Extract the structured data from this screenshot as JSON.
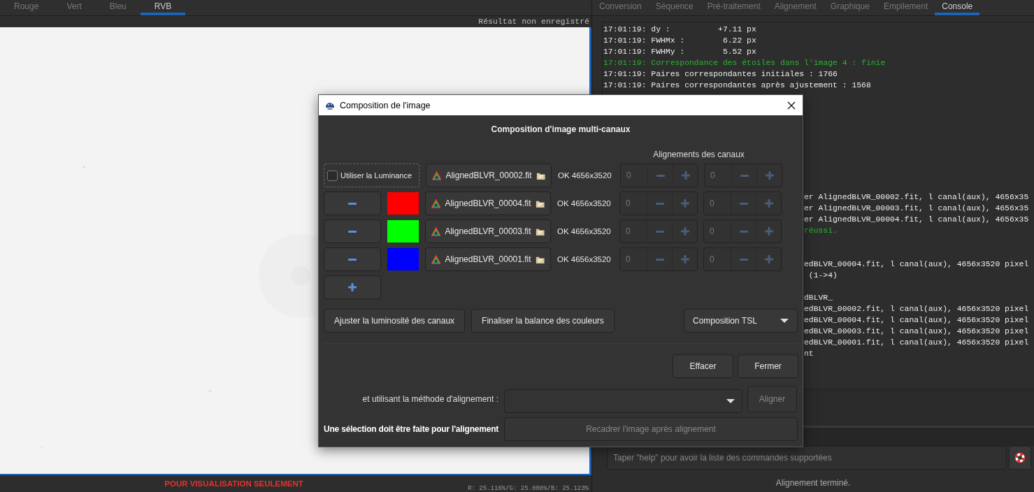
{
  "viewer": {
    "tabs": [
      {
        "label": "Rouge",
        "selected": false
      },
      {
        "label": "Vert",
        "selected": false
      },
      {
        "label": "Bleu",
        "selected": false
      },
      {
        "label": "RVB",
        "selected": true
      }
    ],
    "save_state": "Résultat non enregistré",
    "notice": "POUR VISUALISATION SEULEMENT",
    "pixel_values": "R: 25.116%/G: 25.008%/B: 25.123%"
  },
  "panel": {
    "tabs": [
      {
        "label": "Conversion",
        "selected": false
      },
      {
        "label": "Séquence",
        "selected": false
      },
      {
        "label": "Pré-traitement",
        "selected": false
      },
      {
        "label": "Alignement",
        "selected": false
      },
      {
        "label": "Graphique",
        "selected": false
      },
      {
        "label": "Empilement",
        "selected": false
      },
      {
        "label": "Console",
        "selected": true
      }
    ],
    "console": [
      {
        "kind": "text",
        "partial": false,
        "text": "17:01:19: dy :          +7.11 px"
      },
      {
        "kind": "text",
        "partial": false,
        "text": "17:01:19: FWHMx :        6.22 px"
      },
      {
        "kind": "text",
        "partial": false,
        "text": "17:01:19: FWHMy :        5.52 px"
      },
      {
        "kind": "success",
        "partial": false,
        "text": "17:01:19: Correspondance des étoiles dans l'image 4 : finie"
      },
      {
        "kind": "text",
        "partial": false,
        "text": "17:01:19: Paires correspondantes initiales : 1766"
      },
      {
        "kind": "text",
        "partial": false,
        "text": "17:01:19: Paires correspondantes après ajustement : 1568"
      },
      {
        "kind": "covered"
      },
      {
        "kind": "covered"
      },
      {
        "kind": "covered"
      },
      {
        "kind": "covered"
      },
      {
        "kind": "covered"
      },
      {
        "kind": "covered"
      },
      {
        "kind": "covered"
      },
      {
        "kind": "covered"
      },
      {
        "kind": "covered"
      },
      {
        "kind": "text",
        "partial": true,
        "text": "er AlignedBLVR_00002.fit, l canal(aux), 4656x35"
      },
      {
        "kind": "text",
        "partial": true,
        "text": "er AlignedBLVR_00003.fit, l canal(aux), 4656x35"
      },
      {
        "kind": "text",
        "partial": true,
        "text": "er AlignedBLVR_00004.fit, l canal(aux), 4656x35"
      },
      {
        "kind": "success",
        "partial": true,
        "text": "réussi."
      },
      {
        "kind": "covered"
      },
      {
        "kind": "covered"
      },
      {
        "kind": "text",
        "partial": true,
        "text": "edBLVR_00004.fit, l canal(aux), 4656x3520 pixel"
      },
      {
        "kind": "text",
        "partial": true,
        "text": " (1->4)"
      },
      {
        "kind": "covered"
      },
      {
        "kind": "text",
        "partial": true,
        "text": "dBLVR_"
      },
      {
        "kind": "text",
        "partial": true,
        "text": "edBLVR_00002.fit, l canal(aux), 4656x3520 pixel"
      },
      {
        "kind": "text",
        "partial": true,
        "text": "edBLVR_00004.fit, l canal(aux), 4656x3520 pixel"
      },
      {
        "kind": "text",
        "partial": true,
        "text": "edBLVR_00003.fit, l canal(aux), 4656x3520 pixel"
      },
      {
        "kind": "text",
        "partial": true,
        "text": "edBLVR_00001.fit, l canal(aux), 4656x3520 pixel"
      },
      {
        "kind": "text",
        "partial": true,
        "text": "nt"
      }
    ],
    "command": {
      "placeholder": "Taper \"help\" pour avoir la liste des commandes supportées"
    },
    "status": "Alignement terminé."
  },
  "dialog": {
    "title": "Composition de l'image",
    "heading": "Composition d'image multi-canaux",
    "alignment_heading": "Alignements des canaux",
    "luminance": {
      "label": "Utiliser la Luminance",
      "checked": false,
      "file": "AlignedBLVR_00002.fit",
      "status": "OK 4656x3520",
      "offsets": [
        "0",
        "0"
      ]
    },
    "channels": [
      {
        "color": "#ff0000",
        "file": "AlignedBLVR_00004.fit",
        "status": "OK 4656x3520",
        "offsets": [
          "0",
          "0"
        ]
      },
      {
        "color": "#00ff00",
        "file": "AlignedBLVR_00003.fit",
        "status": "OK 4656x3520",
        "offsets": [
          "0",
          "0"
        ]
      },
      {
        "color": "#0000ff",
        "file": "AlignedBLVR_00001.fit",
        "status": "OK 4656x3520",
        "offsets": [
          "0",
          "0"
        ]
      }
    ],
    "actions": [
      "Ajuster la luminosité des canaux",
      "Finaliser la balance des couleurs"
    ],
    "mode": "Composition TSL",
    "buttons": [
      "Effacer",
      "Fermer"
    ],
    "method_label": "et utilisant la méthode d'alignement :",
    "align_button": {
      "label": "Aligner",
      "disabled": true
    },
    "selection_note": "Une sélection doit être faite pour l'alignement",
    "crop_button": {
      "label": "Recadrer l'image après alignement",
      "disabled": true
    }
  }
}
